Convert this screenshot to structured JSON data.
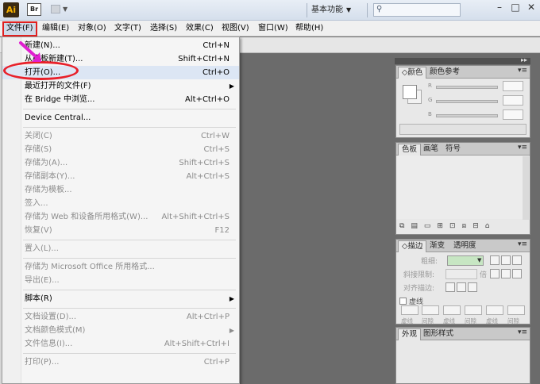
{
  "app": {
    "logo_text": "Ai",
    "bridge_logo_text": "Br",
    "workspace_label": "基本功能",
    "window_buttons": {
      "min": "–",
      "max": "□",
      "close": "✕"
    }
  },
  "menubar": [
    {
      "label": "文件(F)",
      "active": true
    },
    {
      "label": "编辑(E)"
    },
    {
      "label": "对象(O)"
    },
    {
      "label": "文字(T)"
    },
    {
      "label": "选择(S)"
    },
    {
      "label": "效果(C)"
    },
    {
      "label": "视图(V)"
    },
    {
      "label": "窗口(W)"
    },
    {
      "label": "帮助(H)"
    }
  ],
  "file_menu": [
    {
      "label": "新建(N)...",
      "shortcut": "Ctrl+N"
    },
    {
      "label": "从模板新建(T)...",
      "shortcut": "Shift+Ctrl+N"
    },
    {
      "label": "打开(O)...",
      "shortcut": "Ctrl+O",
      "highlighted": true
    },
    {
      "label": "最近打开的文件(F)",
      "submenu": true
    },
    {
      "label": "在 Bridge 中浏览...",
      "shortcut": "Alt+Ctrl+O"
    },
    {
      "separator": true
    },
    {
      "label": "Device Central..."
    },
    {
      "separator": true
    },
    {
      "label": "关闭(C)",
      "shortcut": "Ctrl+W",
      "disabled": true
    },
    {
      "label": "存储(S)",
      "shortcut": "Ctrl+S",
      "disabled": true
    },
    {
      "label": "存储为(A)...",
      "shortcut": "Shift+Ctrl+S",
      "disabled": true
    },
    {
      "label": "存储副本(Y)...",
      "shortcut": "Alt+Ctrl+S",
      "disabled": true
    },
    {
      "label": "存储为模板...",
      "disabled": true
    },
    {
      "label": "签入...",
      "disabled": true
    },
    {
      "label": "存储为 Web 和设备所用格式(W)...",
      "shortcut": "Alt+Shift+Ctrl+S",
      "disabled": true
    },
    {
      "label": "恢复(V)",
      "shortcut": "F12",
      "disabled": true
    },
    {
      "separator": true
    },
    {
      "label": "置入(L)...",
      "disabled": true
    },
    {
      "separator": true
    },
    {
      "label": "存储为 Microsoft Office 所用格式...",
      "disabled": true
    },
    {
      "label": "导出(E)...",
      "disabled": true
    },
    {
      "separator": true
    },
    {
      "label": "脚本(R)",
      "submenu": true
    },
    {
      "separator": true
    },
    {
      "label": "文档设置(D)...",
      "shortcut": "Alt+Ctrl+P",
      "disabled": true
    },
    {
      "label": "文档颜色模式(M)",
      "submenu": true,
      "disabled": true
    },
    {
      "label": "文件信息(I)...",
      "shortcut": "Alt+Shift+Ctrl+I",
      "disabled": true
    },
    {
      "separator": true
    },
    {
      "label": "打印(P)...",
      "shortcut": "Ctrl+P",
      "disabled": true
    }
  ],
  "panels": {
    "color": {
      "tabs": [
        "颜色",
        "颜色参考"
      ],
      "channels": [
        "R",
        "G",
        "B"
      ]
    },
    "swatches": {
      "tabs": [
        "色板",
        "画笔",
        "符号"
      ]
    },
    "stroke": {
      "tabs": [
        "描边",
        "渐变",
        "透明度"
      ],
      "weight_label": "粗细:",
      "miter_label": "斜接限制:",
      "miter_unit": "倍",
      "align_label": "对齐描边:",
      "dashed_label": "虚线",
      "dash_labels": [
        "虚线",
        "间隙",
        "虚线",
        "间隙",
        "虚线",
        "间隙"
      ]
    },
    "appearance": {
      "tabs": [
        "外观",
        "图形样式"
      ]
    }
  },
  "colors": {
    "highlight_ring": "#e8202a",
    "pointer_arrow": "#e020d0",
    "stroke_color": "#c7e6c3"
  }
}
